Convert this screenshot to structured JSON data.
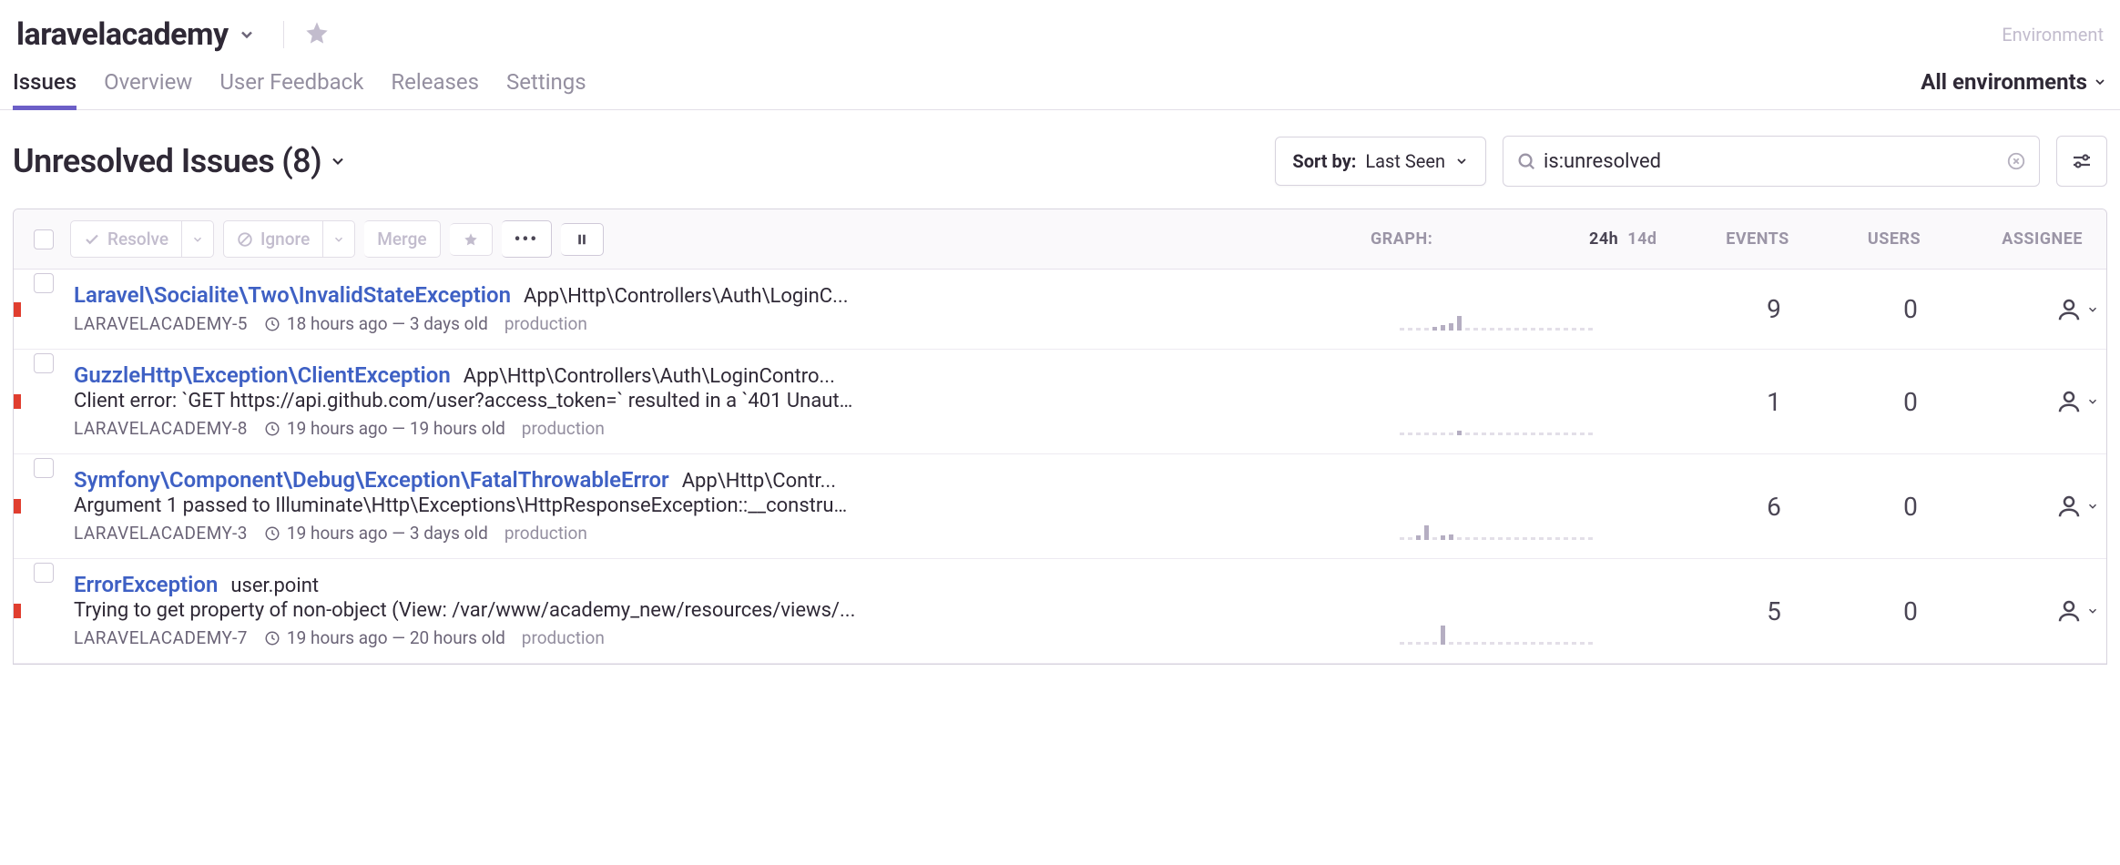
{
  "header": {
    "project_name": "laravelacademy",
    "environment_label": "Environment",
    "environment_value": "All environments"
  },
  "tabs": [
    {
      "id": "issues",
      "label": "Issues",
      "active": true
    },
    {
      "id": "overview",
      "label": "Overview",
      "active": false
    },
    {
      "id": "userfeedback",
      "label": "User Feedback",
      "active": false
    },
    {
      "id": "releases",
      "label": "Releases",
      "active": false
    },
    {
      "id": "settings",
      "label": "Settings",
      "active": false
    }
  ],
  "page": {
    "title": "Unresolved Issues",
    "count_display": "(8)"
  },
  "sort": {
    "label": "Sort by:",
    "value": "Last Seen"
  },
  "search": {
    "value": "is:unresolved"
  },
  "toolbar": {
    "resolve": "Resolve",
    "ignore": "Ignore",
    "merge": "Merge",
    "more": "•••"
  },
  "column_headers": {
    "graph": "GRAPH:",
    "range_24h": "24h",
    "range_14d": "14d",
    "events": "EVENTS",
    "users": "USERS",
    "assignee": "ASSIGNEE"
  },
  "issues": [
    {
      "title": "Laravel\\Socialite\\Two\\InvalidStateException",
      "location": "App\\Http\\Controllers\\Auth\\LoginC...",
      "message": "",
      "issue_id": "LARAVELACADEMY-5",
      "time": "18 hours ago — 3 days old",
      "env": "production",
      "events": "9",
      "users": "0",
      "spark": [
        0,
        0,
        0,
        0,
        2,
        4,
        5,
        10,
        0,
        0,
        0,
        0,
        0,
        0,
        0,
        0,
        0,
        0,
        0,
        0,
        0,
        0,
        0,
        0
      ]
    },
    {
      "title": "GuzzleHttp\\Exception\\ClientException",
      "location": "App\\Http\\Controllers\\Auth\\LoginContro...",
      "message": "Client error: `GET https://api.github.com/user?access_token=` resulted in a `401 Unauth...",
      "issue_id": "LARAVELACADEMY-8",
      "time": "19 hours ago — 19 hours old",
      "env": "production",
      "events": "1",
      "users": "0",
      "spark": [
        0,
        0,
        0,
        0,
        0,
        0,
        0,
        3,
        0,
        0,
        0,
        0,
        0,
        0,
        0,
        0,
        0,
        0,
        0,
        0,
        0,
        0,
        0,
        0
      ]
    },
    {
      "title": "Symfony\\Component\\Debug\\Exception\\FatalThrowableError",
      "location": "App\\Http\\Contr...",
      "message": "Argument 1 passed to Illuminate\\Http\\Exceptions\\HttpResponseException::__construc...",
      "issue_id": "LARAVELACADEMY-3",
      "time": "19 hours ago — 3 days old",
      "env": "production",
      "events": "6",
      "users": "0",
      "spark": [
        0,
        0,
        3,
        10,
        0,
        3,
        4,
        0,
        0,
        0,
        0,
        0,
        0,
        0,
        0,
        0,
        0,
        0,
        0,
        0,
        0,
        0,
        0,
        0
      ]
    },
    {
      "title": "ErrorException",
      "location": "user.point",
      "message": "Trying to get property of non-object (View: /var/www/academy_new/resources/views/...",
      "issue_id": "LARAVELACADEMY-7",
      "time": "19 hours ago — 20 hours old",
      "env": "production",
      "events": "5",
      "users": "0",
      "spark": [
        0,
        0,
        0,
        0,
        0,
        13,
        0,
        0,
        0,
        0,
        0,
        0,
        0,
        0,
        0,
        0,
        0,
        0,
        0,
        0,
        0,
        0,
        0,
        0
      ]
    }
  ]
}
